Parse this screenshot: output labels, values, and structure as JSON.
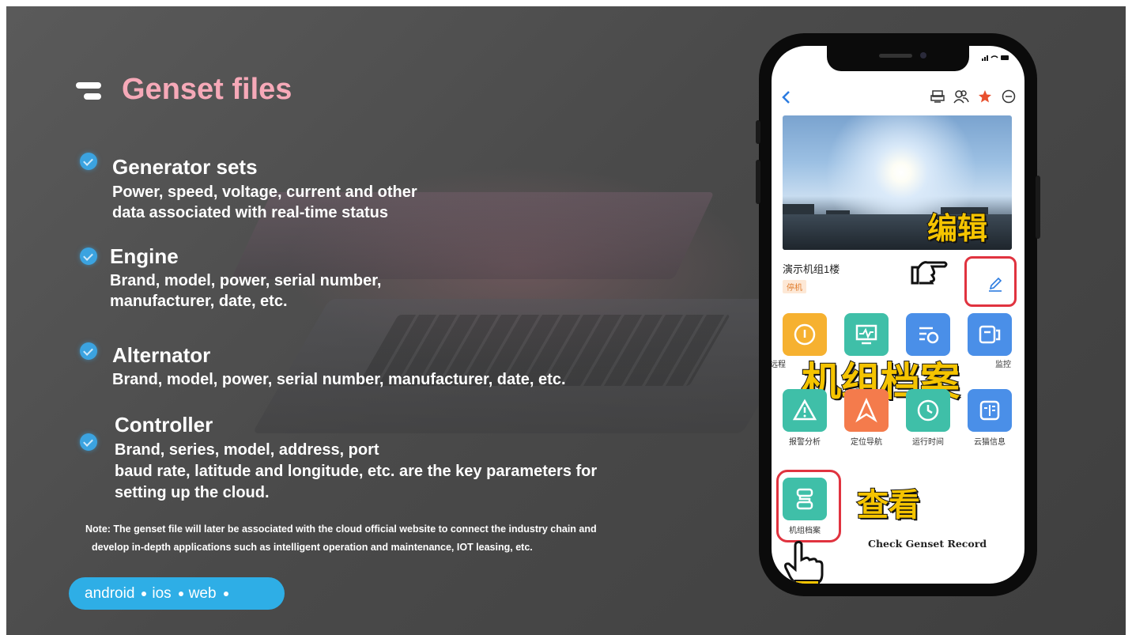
{
  "slide": {
    "title": "Genset files",
    "items": [
      {
        "title": "Generator sets",
        "desc": [
          "Power, speed, voltage, current and other",
          "data associated with real-time status"
        ]
      },
      {
        "title": "Engine",
        "desc": [
          "Brand, model, power, serial number,",
          "manufacturer, date, etc."
        ]
      },
      {
        "title": "Alternator",
        "desc": [
          "Brand, model, power, serial number, manufacturer, date, etc."
        ]
      },
      {
        "title": "Controller",
        "desc": [
          "Brand, series, model, address, port",
          "baud rate, latitude and longitude, etc. are the key parameters for",
          "setting up the cloud."
        ]
      }
    ],
    "note": [
      "Note: The genset file will later be associated with the cloud official website to connect the industry chain and",
      "develop in-depth applications such as intelligent operation and maintenance, IOT leasing, etc."
    ],
    "platforms": [
      "android",
      "ios",
      "web"
    ]
  },
  "phone": {
    "overlay_edit": "编辑",
    "overlay_genset_files": "机组档案",
    "overlay_view": "查看",
    "unit_name": "演示机组1楼",
    "unit_status": "停机",
    "grid_row1": [
      {
        "label": "远程",
        "icon": "gauge-icon",
        "color": "#f6b130"
      },
      {
        "label": "",
        "icon": "monitor-chart-icon",
        "color": "#3fbfa8"
      },
      {
        "label": "",
        "icon": "list-clock-icon",
        "color": "#4a8fe8"
      },
      {
        "label": "监控",
        "icon": "device-icon",
        "color": "#4a8fe8"
      }
    ],
    "grid_row2": [
      {
        "label": "报警分析",
        "icon": "warning-icon",
        "color": "#3fbfa8"
      },
      {
        "label": "定位导航",
        "icon": "navigate-icon",
        "color": "#f47b4c"
      },
      {
        "label": "运行时间",
        "icon": "clock-icon",
        "color": "#3fbfa8"
      },
      {
        "label": "云猫信息",
        "icon": "info-panel-icon",
        "color": "#4a8fe8"
      }
    ],
    "record_tile": {
      "label": "机组档案",
      "icon": "archive-icon",
      "color": "#3fbfa8"
    },
    "check_record": "Check Genset Record"
  },
  "colors": {
    "title": "#f6a9b8",
    "accent": "#2eaee6",
    "highlight": "#e0333f",
    "overlay": "#f5c400"
  }
}
